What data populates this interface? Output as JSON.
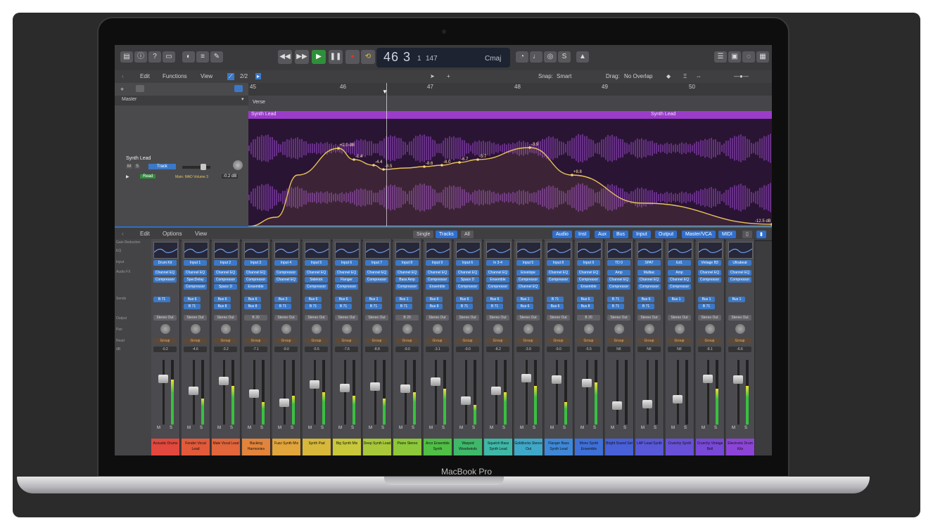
{
  "device": {
    "brand_text": "MacBook Pro"
  },
  "control_bar": {
    "position_bar": "46",
    "position_beat": "3",
    "position_div": "1",
    "position_tick": "147",
    "key": "Cmaj"
  },
  "tracks_header": {
    "menus": [
      "Edit",
      "Functions",
      "View"
    ],
    "snap_label": "Snap:",
    "snap_value": "Smart",
    "drag_label": "Drag:",
    "drag_value": "No Overlap"
  },
  "ruler": {
    "bars": [
      "45",
      "46",
      "47",
      "48",
      "49",
      "50"
    ]
  },
  "marker_track": {
    "label": "Verse"
  },
  "track": {
    "group_label": "Master",
    "name": "Synth Lead",
    "mode_button": "Track",
    "automation_mode": "Read",
    "automation_param": "Main: MAD Volume 3",
    "automation_value": "-0.2 dB",
    "region_left": "Synth Lead",
    "region_right": "Synth Lead",
    "automation_points": [
      "+2.0 dB",
      "-1.4",
      "-4.4",
      "-8.5",
      "-8.6",
      "-8.0",
      "-6.7",
      "-5.7",
      "-3.9",
      "+8.8",
      "-12.5 dB"
    ]
  },
  "mixer_header": {
    "menus": [
      "Edit",
      "Options",
      "View"
    ],
    "view_tabs": [
      {
        "label": "Single",
        "active": false
      },
      {
        "label": "Tracks",
        "active": true
      },
      {
        "label": "All",
        "active": false
      }
    ],
    "filters": [
      "Audio",
      "Inst",
      "Aux",
      "Bus",
      "Input",
      "Output",
      "Master/VCA",
      "MIDI"
    ]
  },
  "row_labels": [
    "Gain Reduction",
    "EQ",
    "Input",
    "Audio FX",
    "Sends",
    "Output",
    "Pan",
    "Read",
    "dB"
  ],
  "strips": [
    {
      "name": "Acoustic Drums",
      "color": "#e2483d",
      "input": "Drum Kit",
      "fx": [
        "Channel EQ",
        "Compressor"
      ],
      "sends": [
        "B 71"
      ],
      "output": "Stereo Out",
      "auto": "Group",
      "db": "-0.2",
      "fader": 0.75,
      "meter": 0.7
    },
    {
      "name": "Fender Vocal Lead",
      "color": "#e25a3a",
      "input": "Input 1",
      "fx": [
        "Channel EQ",
        "SpecDelay",
        "Compressor"
      ],
      "sends": [
        "Bus 6",
        "B 71"
      ],
      "output": "Stereo Out",
      "auto": "Group",
      "db": "-4.6",
      "fader": 0.55,
      "meter": 0.4
    },
    {
      "name": "Male Vocal Lead",
      "color": "#e2653b",
      "input": "Input 2",
      "fx": [
        "Channel EQ",
        "Compressor",
        "Space D"
      ],
      "sends": [
        "Bus 6",
        "Bus 8"
      ],
      "output": "Stereo Out",
      "auto": "Group",
      "db": "-3.2",
      "fader": 0.72,
      "meter": 0.6
    },
    {
      "name": "Backing Harmonies",
      "color": "#e2843b",
      "input": "Input 3",
      "fx": [
        "Channel EQ",
        "Compressor",
        "Ensemble"
      ],
      "sends": [
        "Bus 6",
        "Bus 8"
      ],
      "output": "B 20",
      "auto": "Group",
      "db": "-7.1",
      "fader": 0.5,
      "meter": 0.35
    },
    {
      "name": "Fuzz Synth Mix",
      "color": "#e2a53b",
      "input": "Input 4",
      "fx": [
        "Compressor",
        "Channel EQ"
      ],
      "sends": [
        "Bus 3",
        "B 71"
      ],
      "output": "Stereo Out",
      "auto": "Group",
      "db": "-9.0",
      "fader": 0.35,
      "meter": 0.45
    },
    {
      "name": "Synth Pad",
      "color": "#d8b83a",
      "input": "Input 5",
      "fx": [
        "Channel EQ",
        "Sidekick",
        "Compressor"
      ],
      "sends": [
        "Bus 6",
        "B 71"
      ],
      "output": "Stereo Out",
      "auto": "Group",
      "db": "-5.5",
      "fader": 0.65,
      "meter": 0.5
    },
    {
      "name": "Big Synth Mix",
      "color": "#c8c83a",
      "input": "Input 6",
      "fx": [
        "Channel EQ",
        "Flanger",
        "Compressor"
      ],
      "sends": [
        "Bus 6",
        "B 71"
      ],
      "output": "Stereo Out",
      "auto": "Group",
      "db": "-7.6",
      "fader": 0.6,
      "meter": 0.45
    },
    {
      "name": "Deep Synth Lead",
      "color": "#a8c83a",
      "input": "Input 7",
      "fx": [
        "Channel EQ",
        "Compressor"
      ],
      "sends": [
        "Bus 1",
        "B 71"
      ],
      "output": "Stereo Out",
      "auto": "Group",
      "db": "-8.8",
      "fader": 0.62,
      "meter": 0.4
    },
    {
      "name": "Piano Stereo",
      "color": "#8cc83a",
      "input": "Input 8",
      "fx": [
        "Channel EQ",
        "Bass Amp",
        "Compressor"
      ],
      "sends": [
        "Bus 1",
        "B 71"
      ],
      "output": "B 20",
      "auto": "Group",
      "db": "-9.0",
      "fader": 0.58,
      "meter": 0.5
    },
    {
      "name": "Arco Ensemble Synth",
      "color": "#4fbf45",
      "input": "Input 9",
      "fx": [
        "Channel EQ",
        "Compressor",
        "Ensemble"
      ],
      "sends": [
        "Bus 6",
        "Bus 8"
      ],
      "output": "Stereo Out",
      "auto": "Group",
      "db": "-3.1",
      "fader": 0.7,
      "meter": 0.55
    },
    {
      "name": "Warped Woodwinds",
      "color": "#3fb86a",
      "input": "Input 6",
      "fx": [
        "Channel EQ",
        "Space D",
        "Compressor"
      ],
      "sends": [
        "Bus 6",
        "B 71"
      ],
      "output": "Stereo Out",
      "auto": "Group",
      "db": "-9.0",
      "fader": 0.38,
      "meter": 0.3
    },
    {
      "name": "Squelch Bass Synth Lead",
      "color": "#3fb8a8",
      "input": "In 3-4",
      "fx": [
        "Channel EQ",
        "Ensemble",
        "Compressor"
      ],
      "sends": [
        "Bus 6",
        "B 71"
      ],
      "output": "Stereo Out",
      "auto": "Group",
      "db": "-8.2",
      "fader": 0.55,
      "meter": 0.5
    },
    {
      "name": "Goldilocks Stereo Out",
      "color": "#3fa8c8",
      "input": "Input 5",
      "fx": [
        "Envelope",
        "Compressor",
        "Channel EQ"
      ],
      "sends": [
        "Bus 1",
        "Bus 6"
      ],
      "output": "Stereo Out",
      "auto": "Group",
      "db": "-3.9",
      "fader": 0.76,
      "meter": 0.6
    },
    {
      "name": "Flanger Bass Synth Lead",
      "color": "#3f88d8",
      "input": "Input 8",
      "fx": [
        "Channel EQ",
        "Compressor"
      ],
      "sends": [
        "B 71",
        "Bus 6"
      ],
      "output": "Stereo Out",
      "auto": "Group",
      "db": "-9.0",
      "fader": 0.74,
      "meter": 0.35
    },
    {
      "name": "Mono Synth Ensemble",
      "color": "#3f70d8",
      "input": "Input 9",
      "fx": [
        "Channel EQ",
        "Compressor",
        "Ensemble"
      ],
      "sends": [
        "Bus 6",
        "Bus 8"
      ],
      "output": "B 20",
      "auto": "Group",
      "db": "-5.5",
      "fader": 0.68,
      "meter": 0.65
    },
    {
      "name": "Bright Sound Set",
      "color": "#4860d8",
      "input": "TD 0",
      "fx": [
        "Amp",
        "Channel EQ",
        "Compressor"
      ],
      "sends": [
        "B 71",
        "B 71"
      ],
      "output": "Stereo Out",
      "auto": "Group",
      "db": "N/I",
      "fader": 0.3,
      "meter": 0.0
    },
    {
      "name": "LAP Lead Synth",
      "color": "#5858d8",
      "input": "SPAT",
      "fx": [
        "Multiac",
        "Channel EQ",
        "Compressor"
      ],
      "sends": [
        "Bus 6",
        "B 71"
      ],
      "output": "Stereo Out",
      "auto": "Group",
      "db": "N/I",
      "fader": 0.32,
      "meter": 0.0
    },
    {
      "name": "Crunchy Synth",
      "color": "#6850d8",
      "input": "Ed1",
      "fx": [
        "Amp",
        "Channel EQ",
        "Compressor"
      ],
      "sends": [
        "Bus 1"
      ],
      "output": "Stereo Out",
      "auto": "Group",
      "db": "N/I",
      "fader": 0.4,
      "meter": 0.0
    },
    {
      "name": "Crunchy Vintage Bell",
      "color": "#7848d8",
      "input": "Vintage B3",
      "fx": [
        "Channel EQ",
        "Compressor"
      ],
      "sends": [
        "Bus 1",
        "B 71"
      ],
      "output": "Stereo Out",
      "auto": "Group",
      "db": "-8.1",
      "fader": 0.75,
      "meter": 0.55
    },
    {
      "name": "Electronic Drum Kits",
      "color": "#8c44d8",
      "input": "Ultrabeat",
      "fx": [
        "Channel EQ",
        "Compressor"
      ],
      "sends": [
        "Bus 1"
      ],
      "output": "Stereo Out",
      "auto": "Group",
      "db": "-6.6",
      "fader": 0.74,
      "meter": 0.6
    }
  ]
}
